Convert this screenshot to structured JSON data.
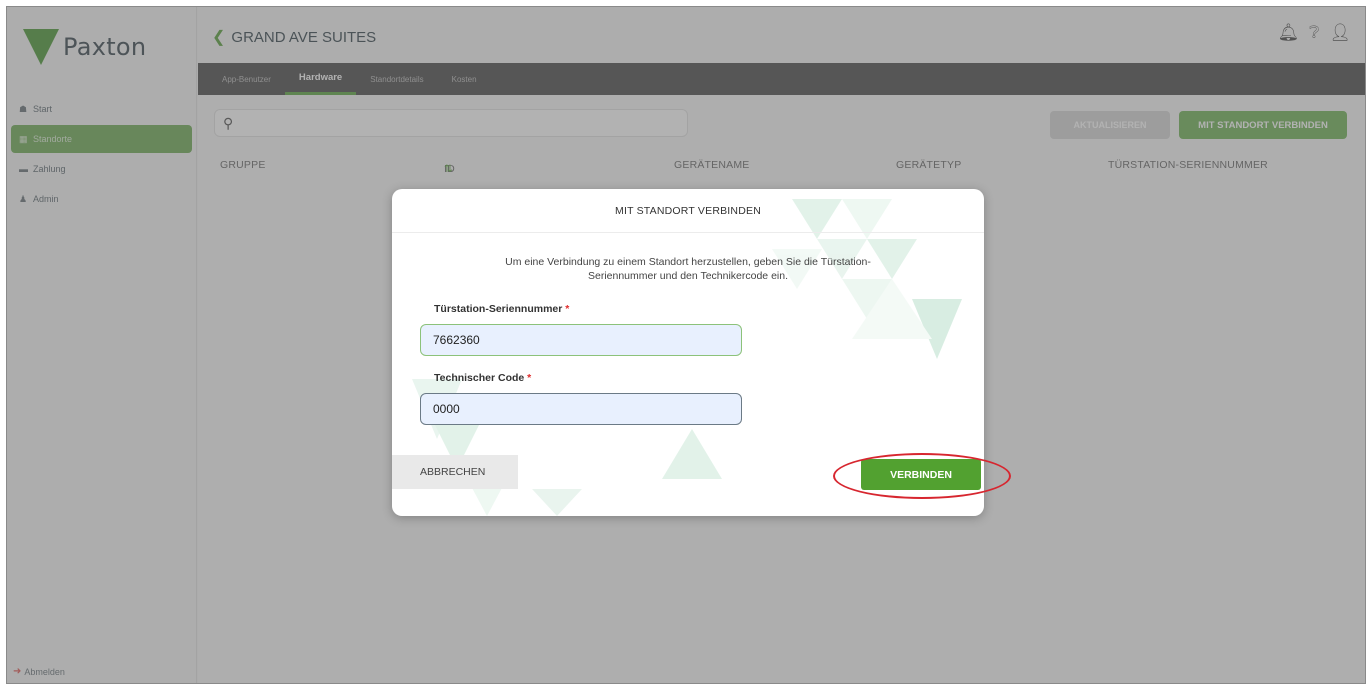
{
  "app": {
    "logo_text": "Paxton",
    "brand_color": "#4f9a3b"
  },
  "sidebar": {
    "items": [
      {
        "icon": "home-icon",
        "label": "Start",
        "active": false
      },
      {
        "icon": "sites-icon",
        "label": "Standorte",
        "active": true
      },
      {
        "icon": "card-icon",
        "label": "Zahlung",
        "active": false
      },
      {
        "icon": "user-icon",
        "label": "Admin",
        "active": false
      }
    ],
    "logout_label": "Abmelden"
  },
  "header": {
    "title": "GRAND AVE SUITES",
    "icons": [
      "bell-icon",
      "help-icon",
      "user-icon"
    ]
  },
  "tabs": [
    {
      "label": "App-Benutzer",
      "active": false
    },
    {
      "label": "Hardware",
      "active": true
    },
    {
      "label": "Standortdetails",
      "active": false
    },
    {
      "label": "Kosten",
      "active": false
    }
  ],
  "toolbar": {
    "search_placeholder": "",
    "update_label": "AKTUALISIEREN",
    "connect_label": "MIT STANDORT VERBINDEN"
  },
  "table": {
    "columns": [
      "GRUPPE",
      "ID",
      "GERÄTENAME",
      "GERÄTETYP",
      "TÜRSTATION-SERIENNUMMER"
    ],
    "sort_icon": "⇅"
  },
  "modal": {
    "title": "MIT STANDORT VERBINDEN",
    "description_line1": "Um eine Verbindung zu einem Standort herzustellen, geben Sie die Türstation-",
    "description_line2": "Seriennummer und den Technikercode ein.",
    "serial_label": "Türstation-Seriennummer",
    "serial_value": "7662360",
    "code_label": "Technischer Code",
    "code_value": "0000",
    "required_mark": "*",
    "cancel_label": "ABBRECHEN",
    "submit_label": "VERBINDEN"
  },
  "colors": {
    "accent_green": "#52a130",
    "highlight_red": "#d7262f"
  }
}
